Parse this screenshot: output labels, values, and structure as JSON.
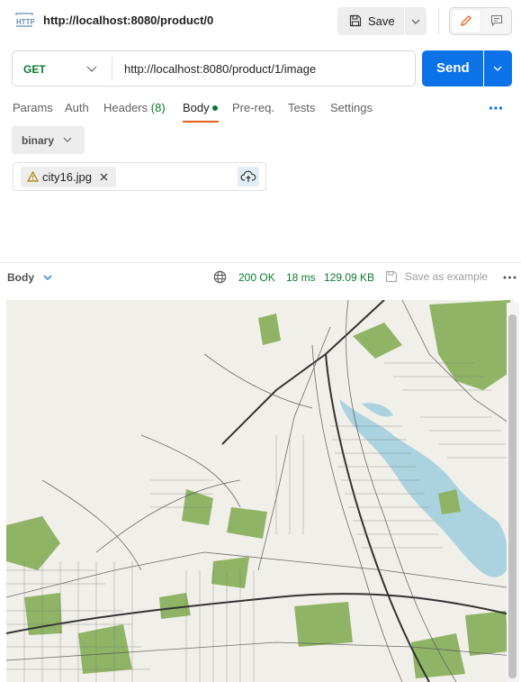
{
  "header": {
    "request_name": "http://localhost:8080/product/0",
    "save_label": "Save"
  },
  "request": {
    "method": "GET",
    "url": "http://localhost:8080/product/1/image",
    "send_label": "Send"
  },
  "tabs": [
    {
      "label": "Params"
    },
    {
      "label": "Auth"
    },
    {
      "label": "Headers",
      "count": "(8)"
    },
    {
      "label": "Body",
      "active": true
    },
    {
      "label": "Pre-req."
    },
    {
      "label": "Tests"
    },
    {
      "label": "Settings"
    }
  ],
  "body": {
    "type": "binary",
    "file_name": "city16.jpg"
  },
  "response": {
    "view_label": "Body",
    "status": "200 OK",
    "time": "18 ms",
    "size": "129.09 KB",
    "save_example_label": "Save as example"
  },
  "colors": {
    "accent_blue": "#0b72e7",
    "status_green": "#0b7a2f",
    "active_tab_underline": "#e8611a"
  },
  "icons": [
    "http-icon",
    "save-icon",
    "chevron-down-icon",
    "pencil-icon",
    "comment-icon",
    "more-icon",
    "warning-icon",
    "close-icon",
    "cloud-upload-icon",
    "globe-icon"
  ]
}
